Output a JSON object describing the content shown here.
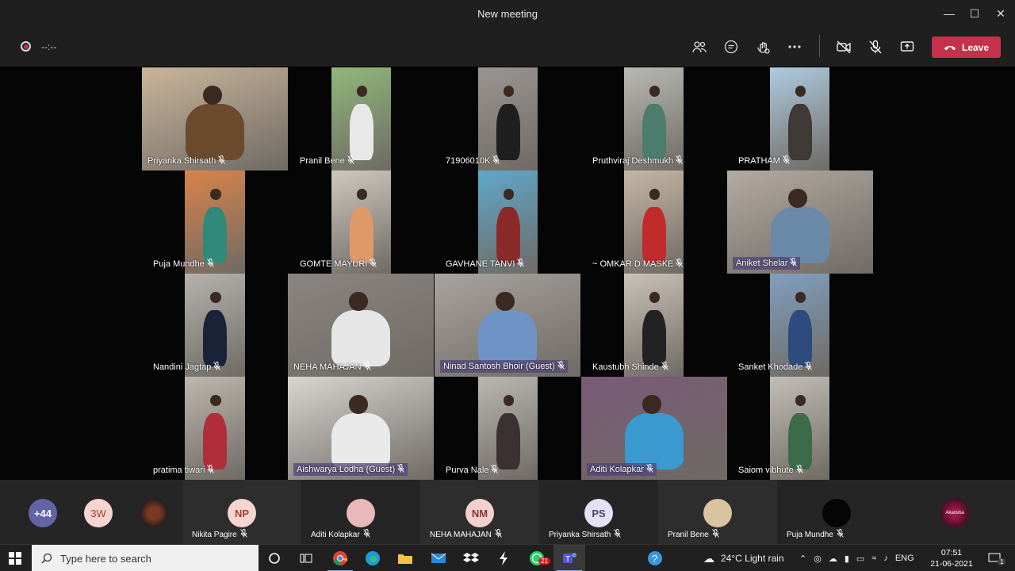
{
  "window": {
    "title": "New meeting"
  },
  "toolbar": {
    "timer": "--:--",
    "leave_label": "Leave"
  },
  "tiles": [
    {
      "name": "Priyanka Shirsath",
      "bg": "#c9b59a",
      "fg": "#6b4a2e"
    },
    {
      "name": "Pranil Bene",
      "bg": "#8fb879",
      "fg": "#e8e8e8"
    },
    {
      "name": "71906010K",
      "bg": "#9a9590",
      "fg": "#1f1f1f"
    },
    {
      "name": "Pruthviraj Deshmukh",
      "bg": "#b8b8b2",
      "fg": "#4c7c6c"
    },
    {
      "name": "PRATHAM",
      "bg": "#aecbe0",
      "fg": "#3f3a35"
    },
    {
      "name": "Puja Mundhe",
      "bg": "#d8834a",
      "fg": "#2f8a7a"
    },
    {
      "name": "GOMTE MAYURI",
      "bg": "#cfc8c0",
      "fg": "#e09a6a"
    },
    {
      "name": "GAVHANE TANVI",
      "bg": "#5fa7c9",
      "fg": "#8a2a2a"
    },
    {
      "name": "~ OMKAR D MASKE",
      "bg": "#c4b6a4",
      "fg": "#c22b2b"
    },
    {
      "name": "Aniket Shelar",
      "bg": "#b3aaa2",
      "fg": "#6a89a8"
    },
    {
      "name": "Nandini Jagtap",
      "bg": "#b5b2ad",
      "fg": "#1b2338"
    },
    {
      "name": "NEHA MAHAJAN",
      "bg": "#8a8580",
      "fg": "#e6e6e6"
    },
    {
      "name": "Ninad Santosh Bhoir (Guest)",
      "bg": "#a8a39e",
      "fg": "#6f93c4"
    },
    {
      "name": "Kaustubh Shinde",
      "bg": "#c9c2b7",
      "fg": "#222"
    },
    {
      "name": "Sanket Khodade",
      "bg": "#7f9fbf",
      "fg": "#2d4c7d"
    },
    {
      "name": "pratima tiwari",
      "bg": "#bcb6ad",
      "fg": "#b02d3a"
    },
    {
      "name": "Aishwarya Lodha (Guest)",
      "bg": "#d8d6d2",
      "fg": "#e9e9e9"
    },
    {
      "name": "Purva Nale",
      "bg": "#b9b6b1",
      "fg": "#3a3232"
    },
    {
      "name": "Aditi Kolapkar",
      "bg": "#7a5a78",
      "fg": "#3a9ad0"
    },
    {
      "name": "Saiom vibhute",
      "bg": "#c2bdb6",
      "fg": "#3b6b4a"
    }
  ],
  "roster": {
    "overflow": "+44",
    "tw_initials": "3W",
    "participants": [
      {
        "initials": "NP",
        "name": "Nikita Pagire",
        "bg": "#f6d4cf",
        "color": "#a0412d"
      },
      {
        "initials": "",
        "name": "Aditi Kolapkar",
        "bg": "#e8b9b8",
        "color": "#333"
      },
      {
        "initials": "NM",
        "name": "NEHA MAHAJAN",
        "bg": "#f3cfcf",
        "color": "#8a3434"
      },
      {
        "initials": "PS",
        "name": "Priyanka Shirsath",
        "bg": "#e4e1f4",
        "color": "#464775"
      },
      {
        "initials": "",
        "name": "Pranil Bene",
        "bg": "#d9c3a0",
        "color": "#333"
      },
      {
        "initials": "",
        "name": "Puja Mundhe",
        "bg": "#050505",
        "color": "#fff"
      }
    ],
    "last_avatar_text": "Akansha"
  },
  "taskbar": {
    "search_placeholder": "Type here to search",
    "whatsapp_badge": "21",
    "weather": "24°C  Light rain",
    "lang": "ENG",
    "time": "07:51",
    "date": "21-06-2021",
    "notif_count": "1"
  }
}
